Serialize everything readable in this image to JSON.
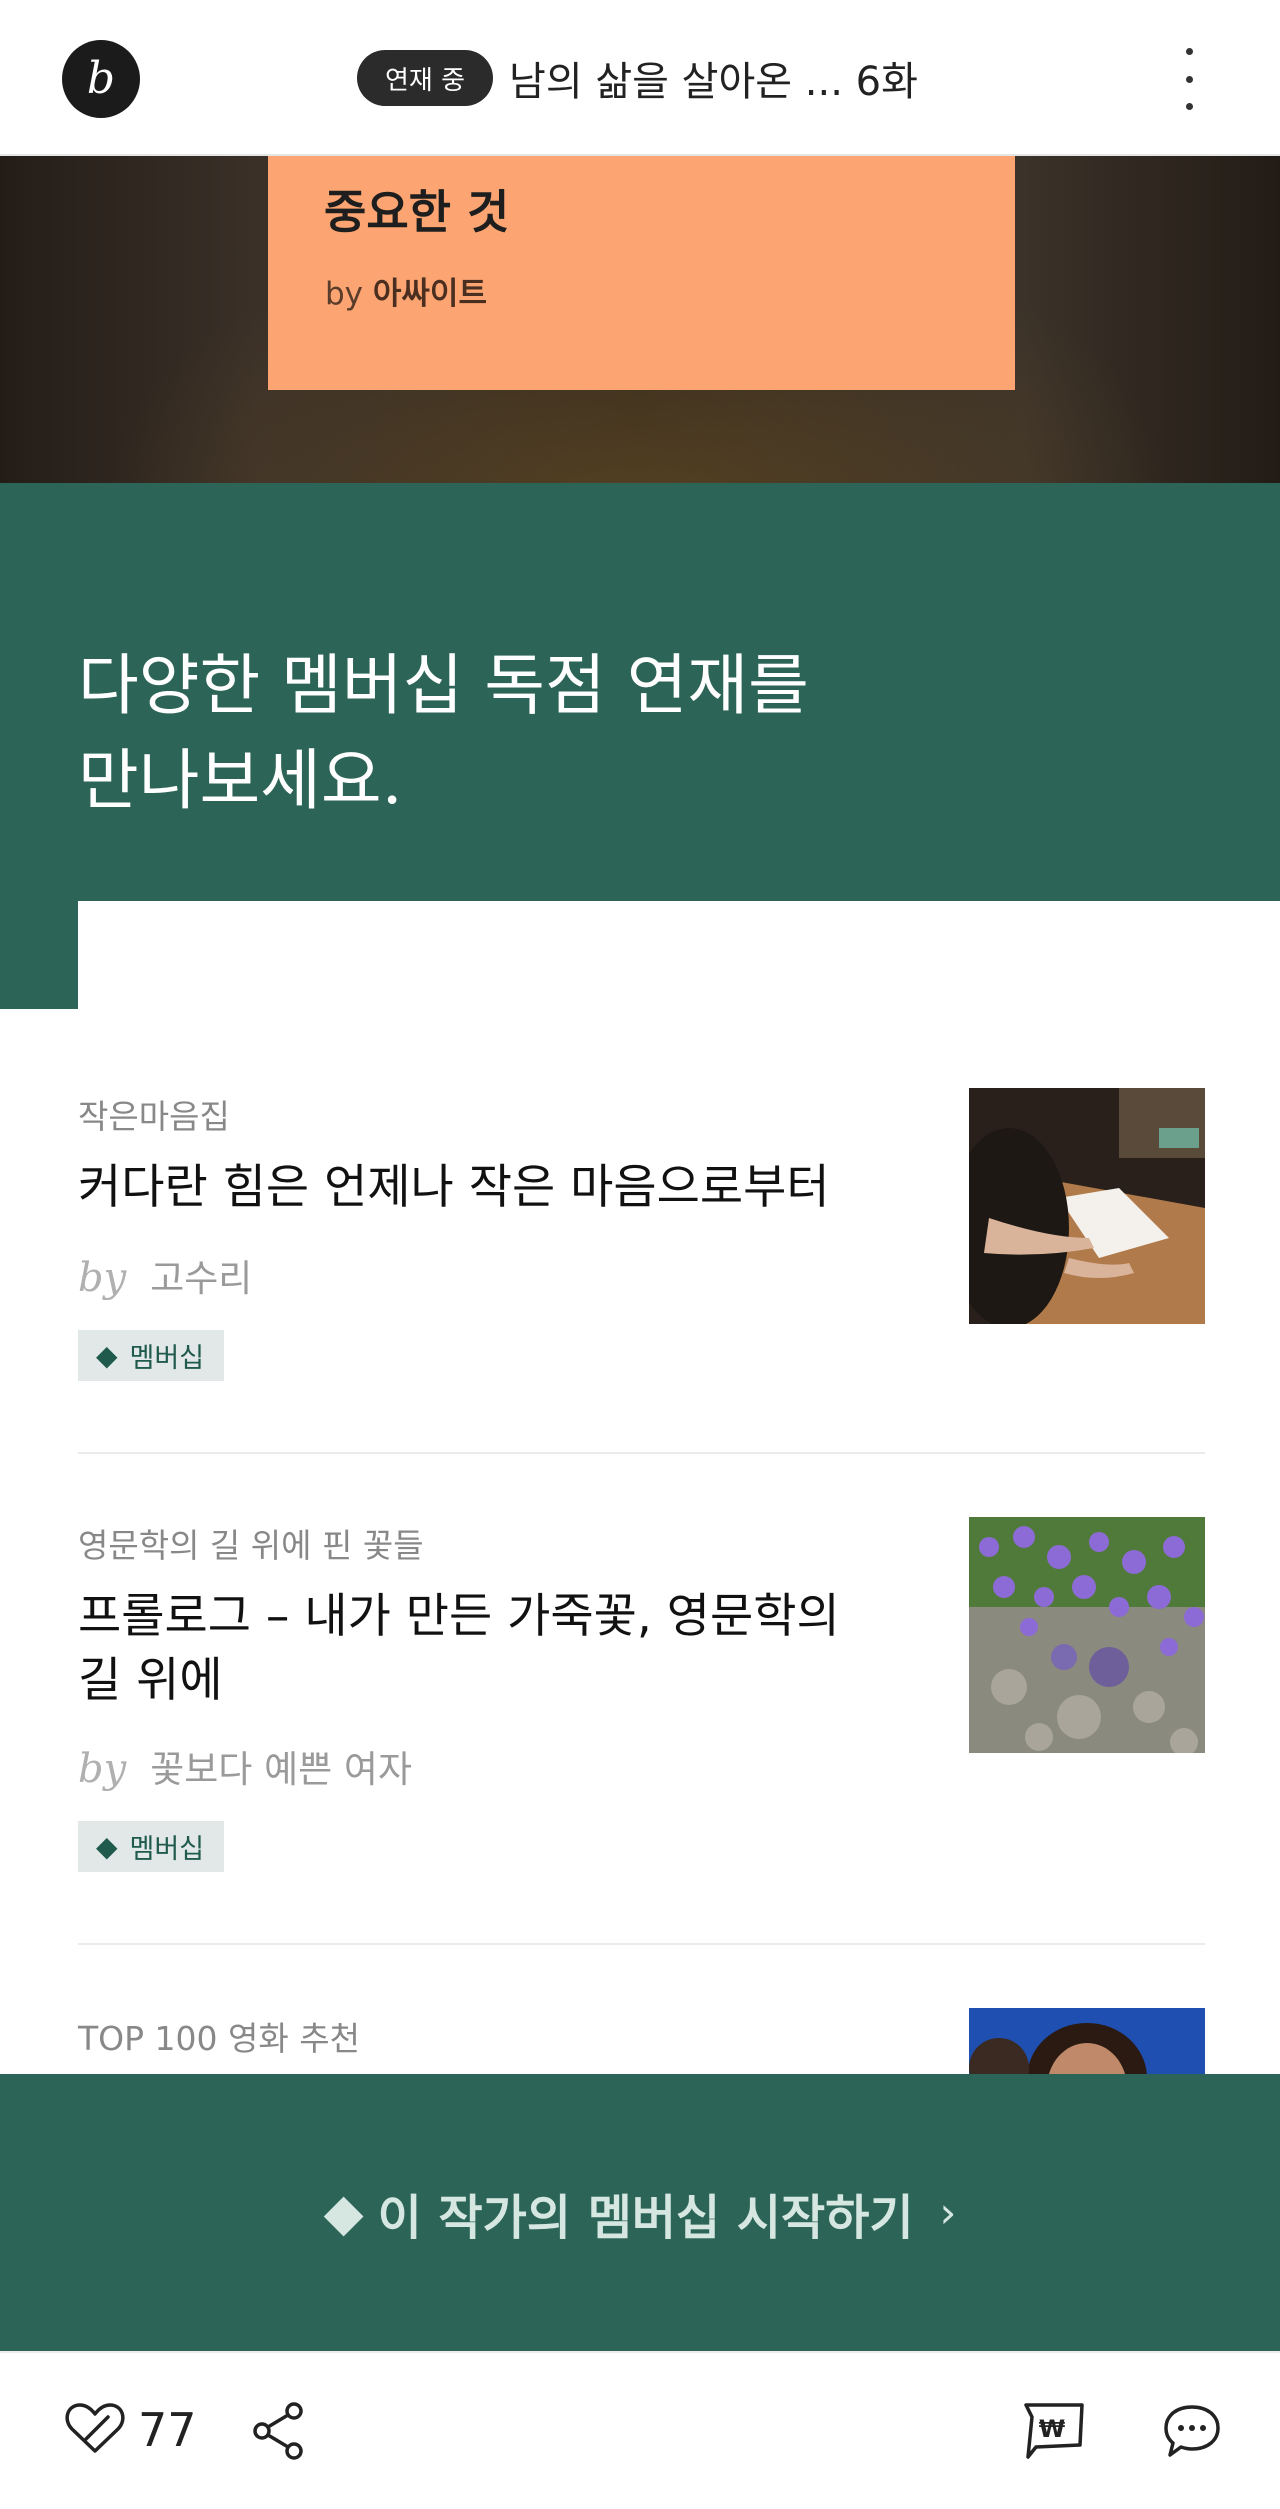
{
  "header": {
    "logo_glyph": "b",
    "serial_badge": "연재 중",
    "title": "남의 삶을 살아온 ... 6화"
  },
  "banner": {
    "title": "중요한 것",
    "by_prefix": "by",
    "author": "아싸이트"
  },
  "membership_section": {
    "heading_line1": "다양한 멤버십 독점 연재를",
    "heading_line2": "만나보세요."
  },
  "articles": [
    {
      "category": "작은마음집",
      "title": "커다란 힘은 언제나 작은 마음으로부터",
      "by": "by",
      "author": "고수리",
      "tag": "멤버십"
    },
    {
      "category": "영문학의 길 위에 핀 꽃들",
      "title": "프롤로그 – 내가 만든 가죽꽃, 영문학의 길 위에",
      "by": "by",
      "author": "꽃보다 예쁜 여자",
      "tag": "멤버십"
    },
    {
      "category": "TOP 100 영화 추천"
    }
  ],
  "cta": {
    "label": "이 작가의 멤버십 시작하기"
  },
  "bottom_bar": {
    "like_count": "77"
  },
  "colors": {
    "membership_green": "#2c6557",
    "banner_card": "#fca572",
    "tag_bg": "#e1e8e7"
  },
  "icons": {
    "logo": "brunch-logo-icon",
    "more": "more-vertical-icon",
    "like": "heart-icon",
    "share": "share-icon",
    "pay": "pay-won-icon",
    "comment": "comment-icon",
    "membership": "diamond-icon",
    "chevron": "chevron-right-icon"
  }
}
